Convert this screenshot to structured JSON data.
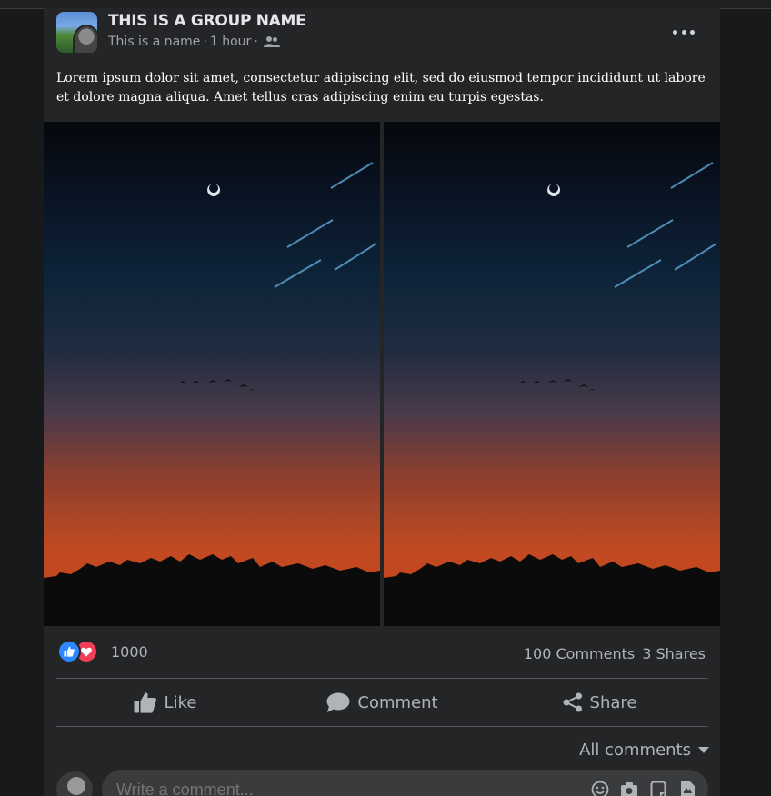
{
  "post": {
    "group_name": "THIS IS A GROUP NAME",
    "author": "This is a name",
    "separator": "·",
    "time": "1 hour",
    "privacy_icon": "people-icon",
    "body": "Lorem ipsum dolor sit amet, consectetur adipiscing elit, sed do eiusmod tempor incididunt ut labore et dolore magna aliqua. Amet tellus cras adipiscing enim eu turpis egestas."
  },
  "reactions": {
    "count": "1000",
    "types": [
      "like-icon",
      "love-icon"
    ],
    "like_color": "#2d88ff",
    "love_color": "#f33e58"
  },
  "counts": {
    "comments": "100 Comments",
    "shares": "3 Shares"
  },
  "actions": {
    "like": "Like",
    "comment": "Comment",
    "share": "Share"
  },
  "comments": {
    "filter_label": "All comments",
    "input_placeholder": "Write a comment..."
  },
  "colors": {
    "background": "#18191a",
    "card": "#242526",
    "text_primary": "#e4e6eb",
    "text_secondary": "#b0b3b8"
  }
}
